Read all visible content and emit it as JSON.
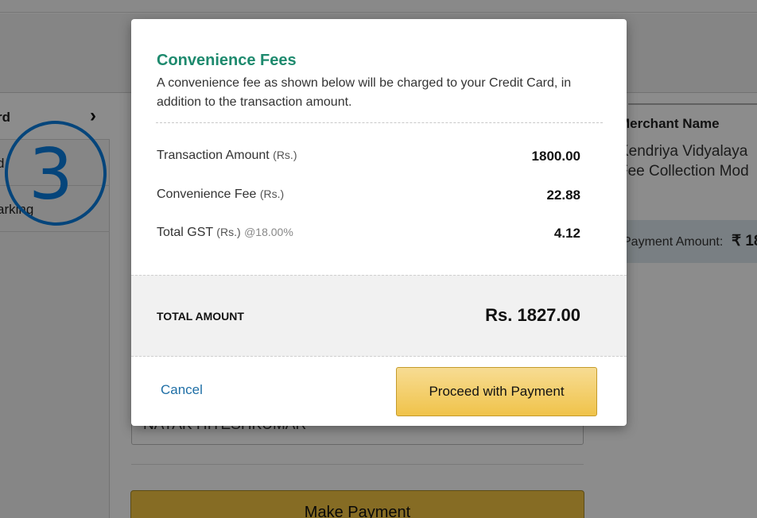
{
  "background": {
    "sidebar": {
      "items": [
        {
          "label": "rd",
          "chevron": "›"
        },
        {
          "label": "d"
        },
        {
          "label": "arking"
        }
      ],
      "annotation_number": "3"
    },
    "merchant": {
      "label": "Merchant Name",
      "value_line1": "Kendriya Vidyalaya",
      "value_line2": "Fee Collection Mod"
    },
    "payment_amount": {
      "label": "Payment Amount:",
      "value": "₹ 18"
    },
    "name_field_value": "NAYAK HITESHKUMAR",
    "make_payment_label": "Make Payment"
  },
  "modal": {
    "title": "Convenience Fees",
    "description": "A convenience fee as shown below will be charged to your Credit Card, in addition to the transaction amount.",
    "rows": [
      {
        "label": "Transaction Amount",
        "unit": "(Rs.)",
        "rate": "",
        "value": "1800.00"
      },
      {
        "label": "Convenience Fee",
        "unit": "(Rs.)",
        "rate": "",
        "value": "22.88"
      },
      {
        "label": "Total GST",
        "unit": "(Rs.)",
        "rate": "@18.00%",
        "value": "4.12"
      }
    ],
    "total_label": "TOTAL AMOUNT",
    "total_value": "Rs. 1827.00",
    "cancel_label": "Cancel",
    "proceed_label": "Proceed with Payment"
  },
  "colors": {
    "title": "#1e8a6e",
    "link": "#1f6fa6",
    "button": "#f0c34a",
    "annotation": "#0a7ee0"
  }
}
